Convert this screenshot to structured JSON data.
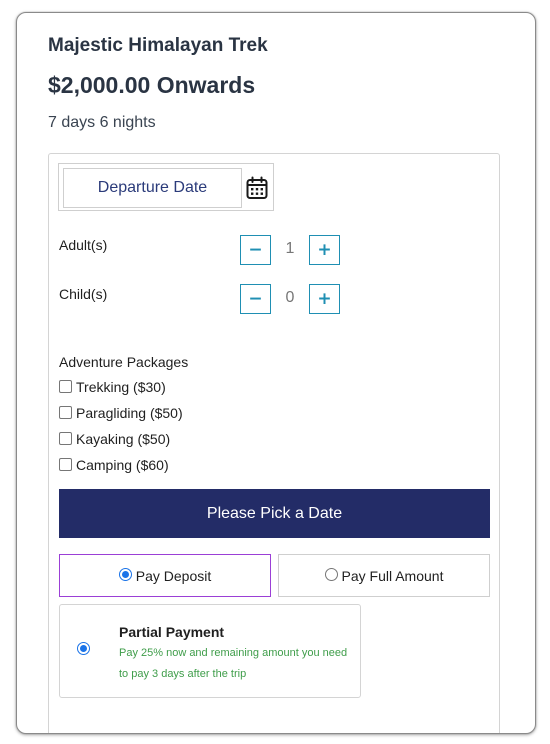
{
  "trip": {
    "title": "Majestic Himalayan Trek",
    "price": "$2,000.00 Onwards",
    "duration": "7 days 6 nights"
  },
  "booking": {
    "date_placeholder": "Departure Date",
    "calendar_icon": "calendar-icon",
    "adults": {
      "label": "Adult(s)",
      "minus": "−",
      "value": "1",
      "plus": "+"
    },
    "children": {
      "label": "Child(s)",
      "minus": "−",
      "value": "0",
      "plus": "+"
    },
    "packages_heading": "Adventure Packages",
    "packages": [
      {
        "label": "Trekking ($30)",
        "checked": false
      },
      {
        "label": "Paragliding ($50)",
        "checked": false
      },
      {
        "label": "Kayaking ($50)",
        "checked": false
      },
      {
        "label": "Camping ($60)",
        "checked": false
      }
    ],
    "submit_label": "Please Pick a Date",
    "payment_options": [
      {
        "label": "Pay Deposit",
        "selected": true
      },
      {
        "label": "Pay Full Amount",
        "selected": false
      }
    ],
    "partial": {
      "title": "Partial Payment",
      "description": "Pay 25% now and remaining amount you need to pay 3 days after the trip",
      "selected": true
    }
  },
  "colors": {
    "primary_button": "#232c67",
    "stepper_accent": "#1f8fb3",
    "selected_border": "#9b3fd6",
    "note_text": "#3f9d4a"
  }
}
